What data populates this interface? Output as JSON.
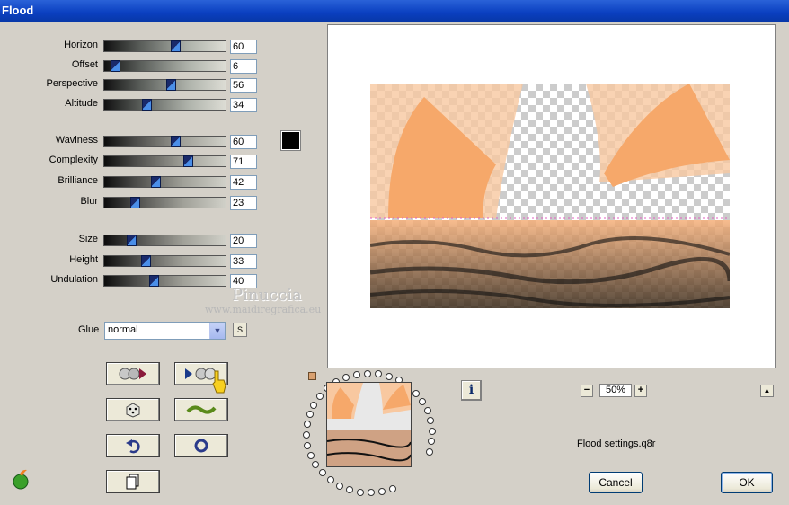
{
  "window": {
    "title": "Flood"
  },
  "sliders_group1": [
    {
      "label": "Horizon",
      "value": "60",
      "pct": 60
    },
    {
      "label": "Offset",
      "value": "6",
      "pct": 6
    },
    {
      "label": "Perspective",
      "value": "56",
      "pct": 56
    },
    {
      "label": "Altitude",
      "value": "34",
      "pct": 34
    }
  ],
  "sliders_group2": [
    {
      "label": "Waviness",
      "value": "60",
      "pct": 60
    },
    {
      "label": "Complexity",
      "value": "71",
      "pct": 71
    },
    {
      "label": "Brilliance",
      "value": "42",
      "pct": 42
    },
    {
      "label": "Blur",
      "value": "23",
      "pct": 23
    }
  ],
  "sliders_group3": [
    {
      "label": "Size",
      "value": "20",
      "pct": 20
    },
    {
      "label": "Height",
      "value": "33",
      "pct": 33
    },
    {
      "label": "Undulation",
      "value": "40",
      "pct": 40
    }
  ],
  "color_swatch": "#000000",
  "glue": {
    "label": "Glue",
    "value": "normal",
    "s_label": "S"
  },
  "watermark": {
    "name": "Pinuccia",
    "url": "www.maidiregrafica.eu"
  },
  "preview": {
    "info_label": "i",
    "zoom": "50%",
    "minus": "−",
    "plus": "+",
    "up": "▲"
  },
  "settings_file": "Flood settings.q8r",
  "buttons": {
    "cancel": "Cancel",
    "ok": "OK"
  },
  "colors": {
    "accent": "#f6a86a",
    "titlebar": "#0a3fc0"
  }
}
